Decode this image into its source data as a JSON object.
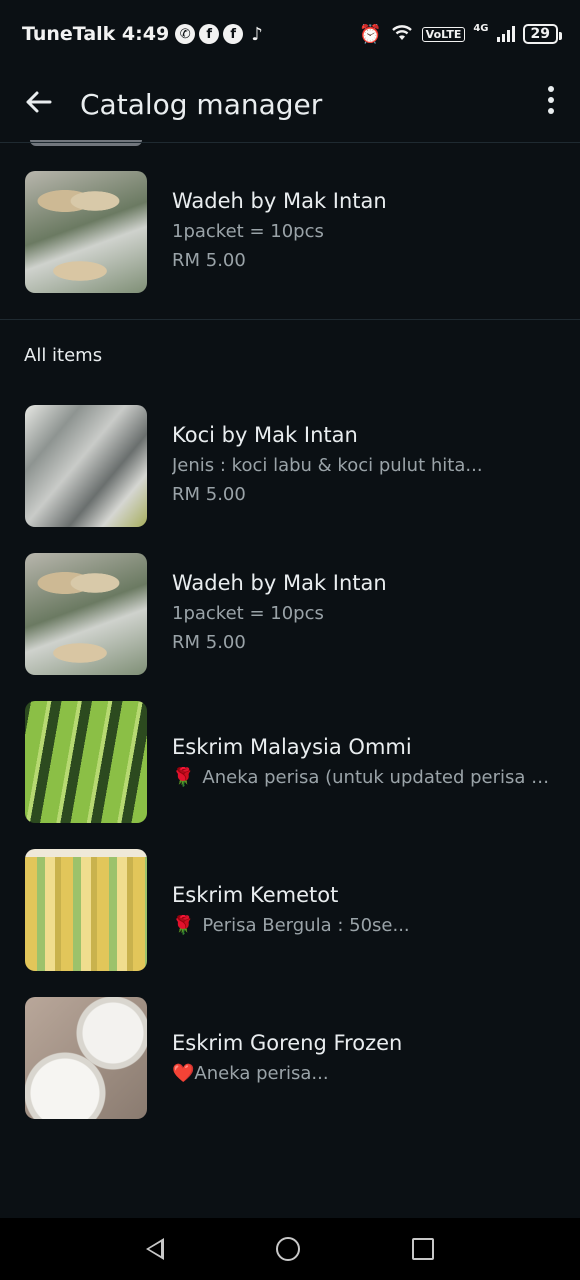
{
  "status_bar": {
    "carrier_time": "TuneTalk 4:49",
    "volte": "VoLTE",
    "network": "4G",
    "battery": "29"
  },
  "header": {
    "title": "Catalog manager"
  },
  "featured_items": [
    {
      "name": "Wadeh by Mak Intan",
      "desc": "1packet = 10pcs",
      "price": "RM 5.00"
    }
  ],
  "section": {
    "label": "All items"
  },
  "items": [
    {
      "name": "Koci by Mak Intan",
      "desc": "Jenis : koci labu & koci pulut hita...",
      "price": "RM 5.00"
    },
    {
      "name": "Wadeh by Mak Intan",
      "desc": "1packet = 10pcs",
      "price": "RM 5.00"
    },
    {
      "name": "Eskrim Malaysia Ommi",
      "emoji": "🌹",
      "desc": "Aneka perisa (untuk updated perisa wasa..."
    },
    {
      "name": "Eskrim Kemetot",
      "emoji": "🌹",
      "desc": "Perisa Bergula : 50se..."
    },
    {
      "name": "Eskrim Goreng Frozen",
      "emoji": "❤️",
      "desc": "Aneka perisa..."
    }
  ]
}
